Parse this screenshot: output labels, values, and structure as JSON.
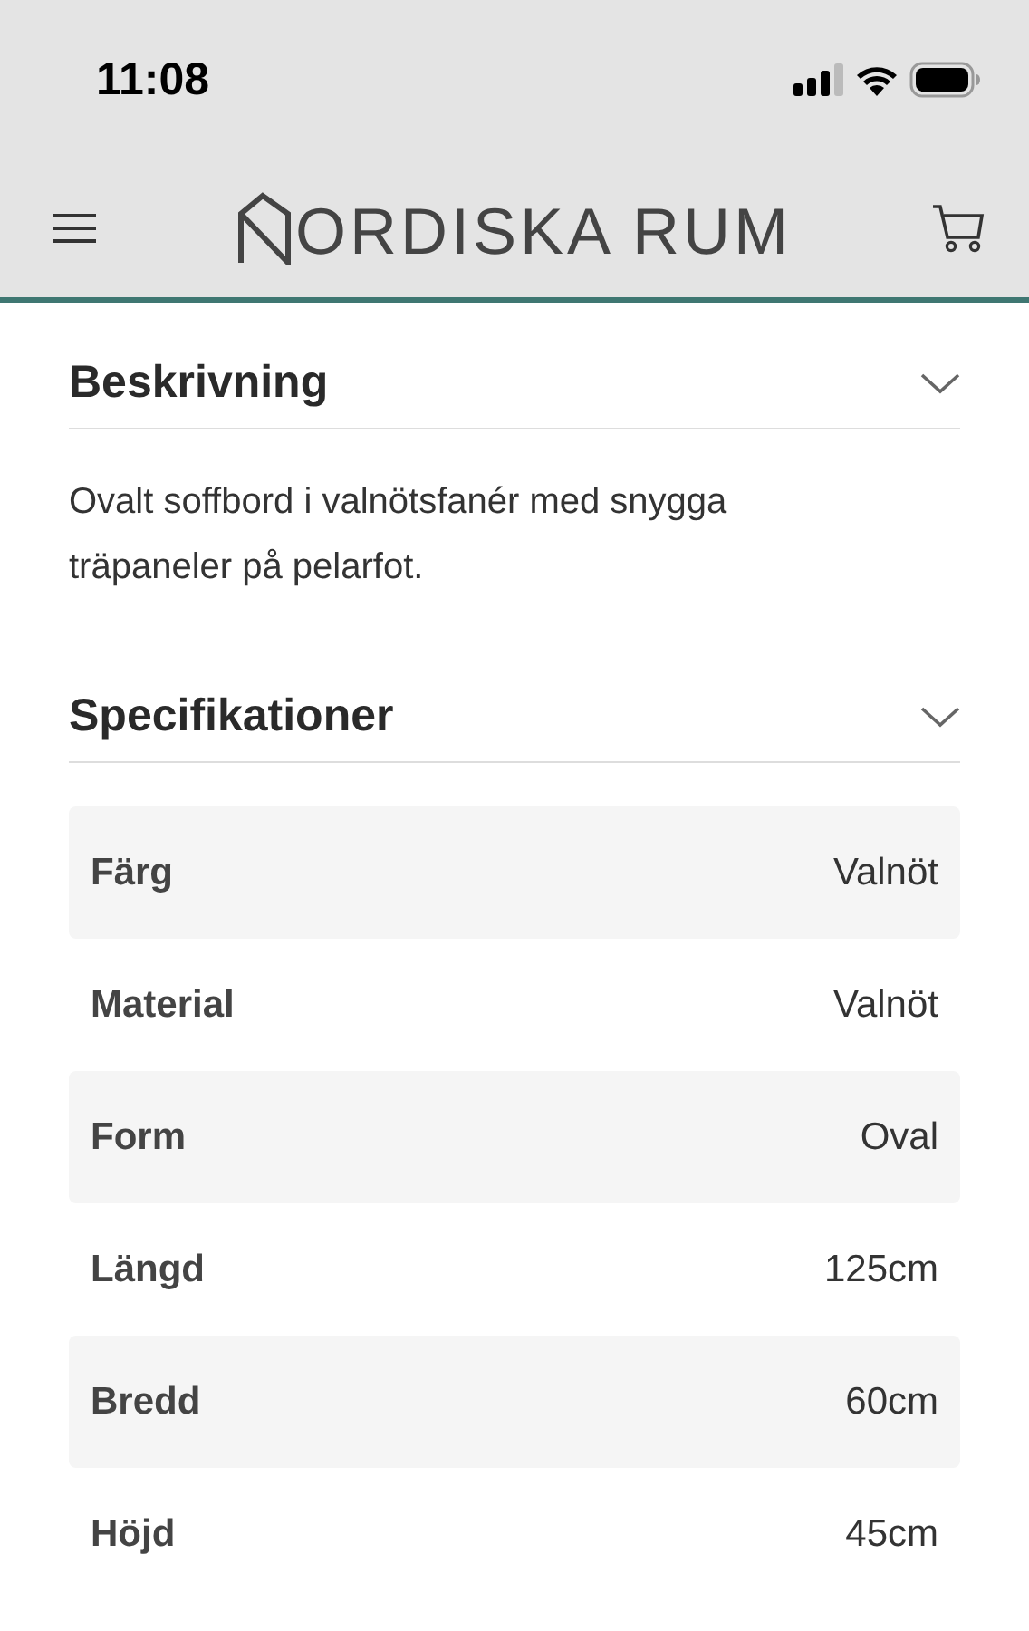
{
  "status_bar": {
    "time": "11:08"
  },
  "header": {
    "logo": "ORDISKA RUM"
  },
  "sections": [
    {
      "title": "Beskrivning",
      "expanded": true,
      "text": "Ovalt soffbord i valnötsfanér med snygga träpaneler på pelarfot."
    },
    {
      "title": "Specifikationer",
      "expanded": true,
      "rows": [
        {
          "label": "Färg",
          "value": "Valnöt"
        },
        {
          "label": "Material",
          "value": "Valnöt"
        },
        {
          "label": "Form",
          "value": "Oval"
        },
        {
          "label": "Längd",
          "value": "125cm"
        },
        {
          "label": "Bredd",
          "value": "60cm"
        },
        {
          "label": "Höjd",
          "value": "45cm"
        }
      ]
    }
  ]
}
